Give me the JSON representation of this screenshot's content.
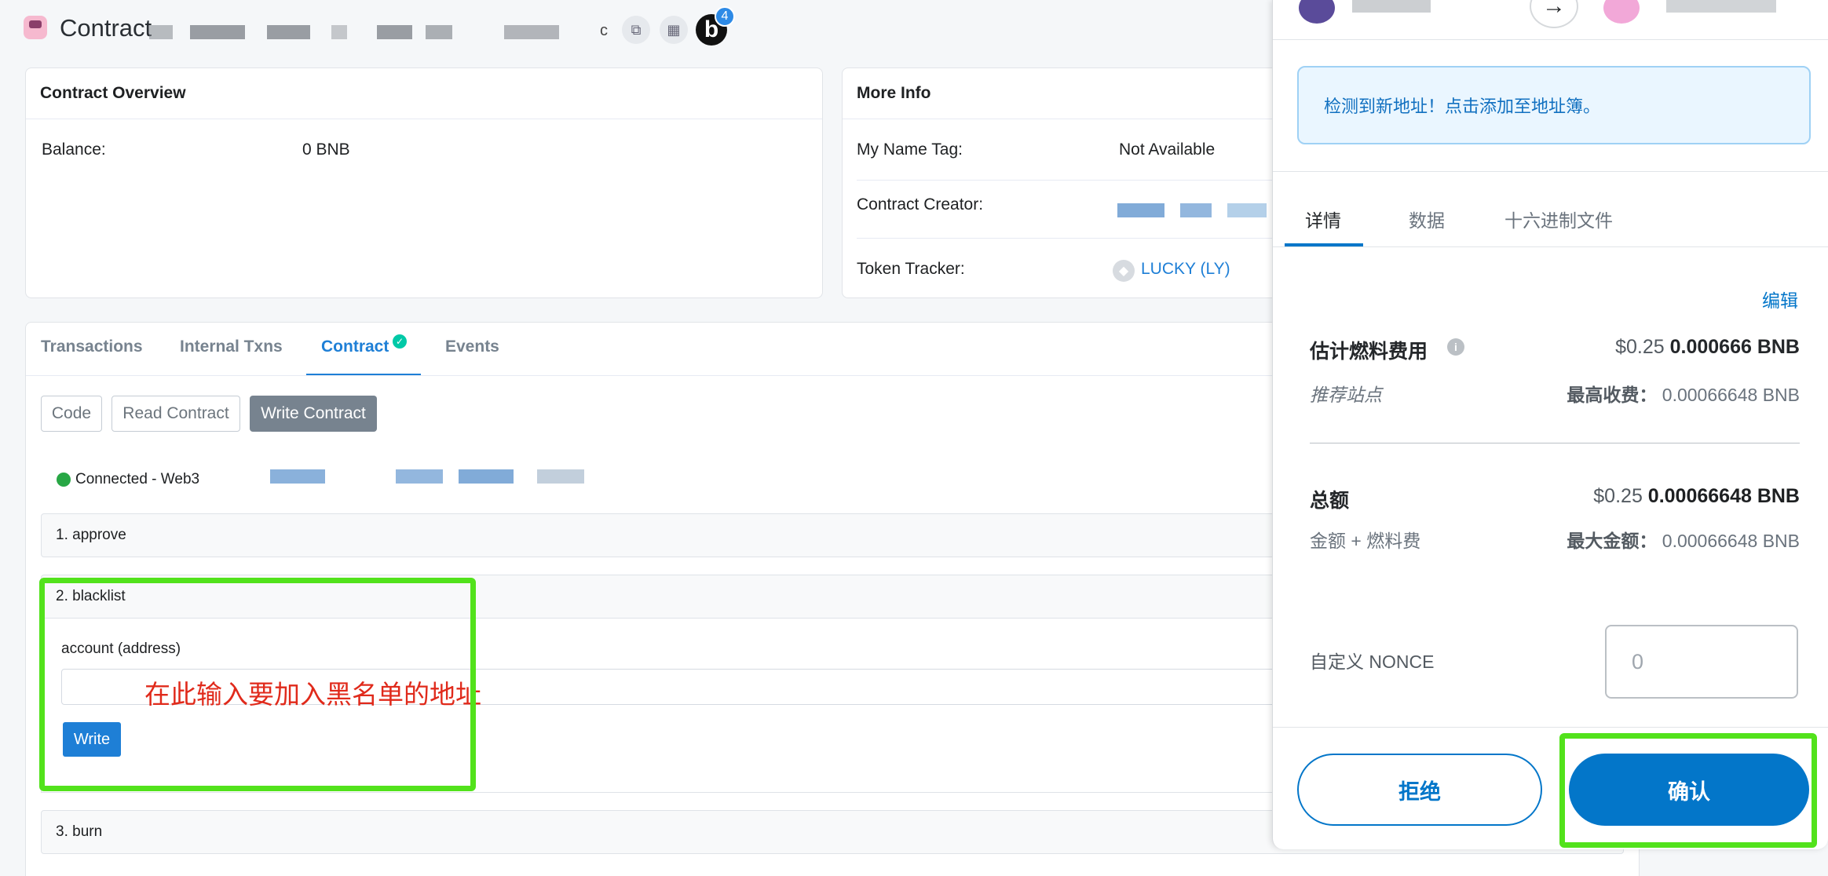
{
  "header": {
    "title": "Contract",
    "address_tail": "c",
    "badge_letter": "b",
    "badge_count": "4"
  },
  "overview": {
    "heading": "Contract Overview",
    "balance_label": "Balance:",
    "balance_value": "0 BNB"
  },
  "more_info": {
    "heading": "More Info",
    "name_tag_label": "My Name Tag:",
    "name_tag_value": "Not Available",
    "creator_label": "Contract Creator:",
    "tracker_label": "Token Tracker:",
    "tracker_value": "LUCKY (LY)"
  },
  "tabs": [
    "Transactions",
    "Internal Txns",
    "Contract",
    "Events"
  ],
  "sub_tabs": {
    "code": "Code",
    "read": "Read Contract",
    "write": "Write Contract"
  },
  "connection": {
    "status": "Connected - Web3"
  },
  "functions": {
    "f1": "1. approve",
    "f2": "2. blacklist",
    "f3": "3. burn",
    "param_label": "account (address)",
    "annotation": "在此输入要加入黑名单的地址",
    "write_label": "Write"
  },
  "wallet": {
    "notice": "检测到新地址！点击添加至地址簿。",
    "tabs": {
      "details": "详情",
      "data": "数据",
      "hex": "十六进制文件"
    },
    "edit": "编辑",
    "gas_label": "估计燃料费用",
    "gas_usd": "$0.25",
    "gas_bnb": "0.000666 BNB",
    "gas_site": "推荐站点",
    "max_fee_label": "最高收费：",
    "max_fee_value": "0.00066648 BNB",
    "total_label": "总额",
    "total_usd": "$0.25",
    "total_bnb": "0.00066648 BNB",
    "total_sub": "金额 + 燃料费",
    "max_amount_label": "最大金额：",
    "max_amount_value": "0.00066648 BNB",
    "nonce_label": "自定义 NONCE",
    "nonce_value": "0",
    "reject": "拒绝",
    "confirm": "确认"
  },
  "colors": {
    "accent": "#1e7fd6",
    "wallet_blue": "#0376c9",
    "highlight": "#52e21b",
    "annotation": "#e02a1b",
    "success": "#28a745"
  }
}
